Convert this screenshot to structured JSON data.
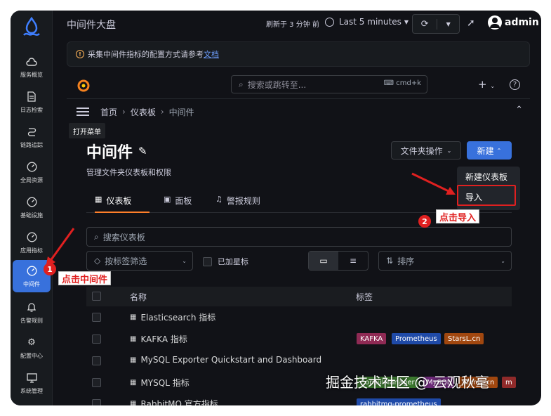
{
  "app": {
    "title": "中间件大盘",
    "refresh_text": "刷新于 3 分钟 前",
    "time_range": "Last 5 minutes",
    "user": "admin"
  },
  "sidebar": {
    "items": [
      {
        "label": "服务概览",
        "icon": "cloud-icon"
      },
      {
        "label": "日志检索",
        "icon": "document-icon"
      },
      {
        "label": "链路追踪",
        "icon": "trace-icon"
      },
      {
        "label": "全局资源",
        "icon": "gauge-icon"
      },
      {
        "label": "基础设施",
        "icon": "gauge-icon"
      },
      {
        "label": "应用指标",
        "icon": "gauge-icon"
      },
      {
        "label": "中间件",
        "icon": "gauge-icon"
      },
      {
        "label": "告警规则",
        "icon": "bell-icon"
      },
      {
        "label": "配置中心",
        "icon": "gear-icon"
      },
      {
        "label": "系统管理",
        "icon": "system-icon"
      }
    ]
  },
  "notice": {
    "text": "采集中间件指标的配置方式请参考",
    "link": "文档"
  },
  "grafana": {
    "search_placeholder": "搜索或跳转至...",
    "shortcut": "cmd+k",
    "breadcrumb": [
      "首页",
      "仪表板",
      "中间件"
    ],
    "menu_tooltip": "打开菜单",
    "page_title": "中间件",
    "subtitle": "管理文件夹仪表板和权限",
    "folder_actions": "文件夹操作",
    "new_button": "新建",
    "new_menu": [
      "新建仪表板",
      "导入"
    ],
    "tabs": [
      "仪表板",
      "面板",
      "警报规则"
    ],
    "search_dashboards": "搜索仪表板",
    "tag_filter": "按标签筛选",
    "starred": "已加星标",
    "sort": "排序",
    "columns": [
      "名称",
      "标签"
    ],
    "rows": [
      {
        "name": "Elasticsearch 指标",
        "tags": []
      },
      {
        "name": "KAFKA 指标",
        "tags": [
          "KAFKA",
          "Prometheus",
          "StarsL.cn"
        ]
      },
      {
        "name": "MySQL Exporter Quickstart and Dashboard",
        "tags": []
      },
      {
        "name": "MYSQL 指标",
        "tags": [
          "ConsulManager",
          "MySQL",
          "StarsL.cn",
          "m"
        ]
      },
      {
        "name": "RabbitMQ 官方指标",
        "tags": [
          "rabbitmq-prometheus"
        ]
      }
    ]
  },
  "annotations": {
    "step1_num": "1",
    "step1_text": "点击中间件",
    "step2_num": "2",
    "step2_text": "点击导入"
  },
  "watermark": "掘金技术社区 @ 云观秋毫",
  "colors": {
    "accent": "#3871dc",
    "tab_underline": "#ff7f2a",
    "annotation": "#e02020"
  }
}
